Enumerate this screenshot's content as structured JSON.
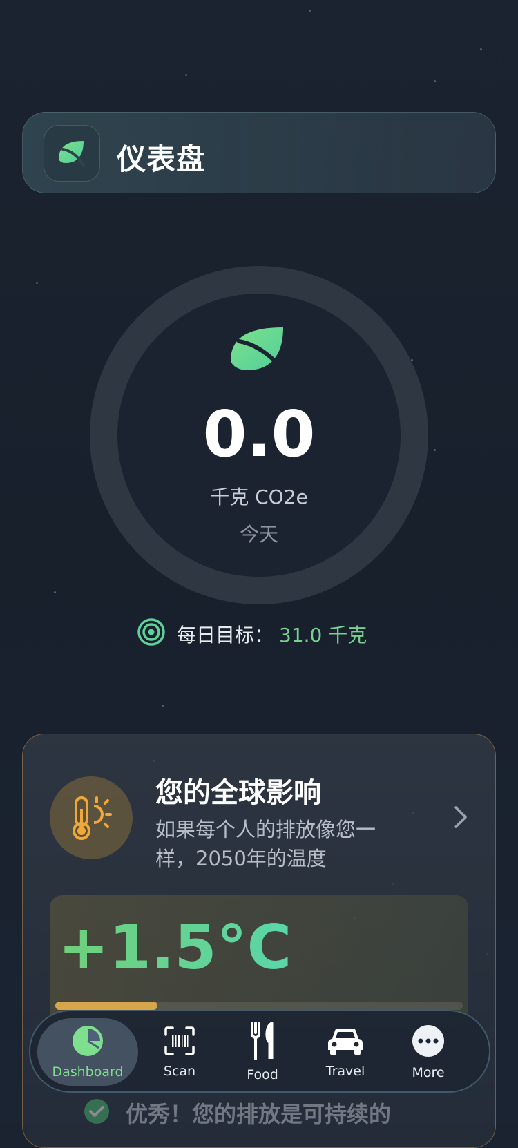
{
  "header": {
    "title": "仪表盘",
    "icon": "leaf-icon"
  },
  "summary": {
    "value": "0.0",
    "unit": "千克 CO2e",
    "period": "今天",
    "icon": "leaf-icon"
  },
  "goal": {
    "label": "每日目标：",
    "value": "31.0 千克",
    "icon": "target-icon"
  },
  "impact": {
    "title": "您的全球影响",
    "subtitle": "如果每个人的排放像您一样，2050年的温度",
    "temperature": "+1.5°C",
    "progress": 0.25,
    "status": "优秀！您的排放是可持续的",
    "icon": "thermometer-sun-icon"
  },
  "tabs": [
    {
      "label": "Dashboard",
      "icon": "pie-chart-icon",
      "active": true
    },
    {
      "label": "Scan",
      "icon": "barcode-scan-icon",
      "active": false
    },
    {
      "label": "Food",
      "icon": "fork-knife-icon",
      "active": false
    },
    {
      "label": "Travel",
      "icon": "car-icon",
      "active": false
    },
    {
      "label": "More",
      "icon": "more-icon",
      "active": false
    }
  ],
  "colors": {
    "accent": "#7ee08e",
    "warning": "#d8a64a",
    "background": "#1b2330"
  }
}
